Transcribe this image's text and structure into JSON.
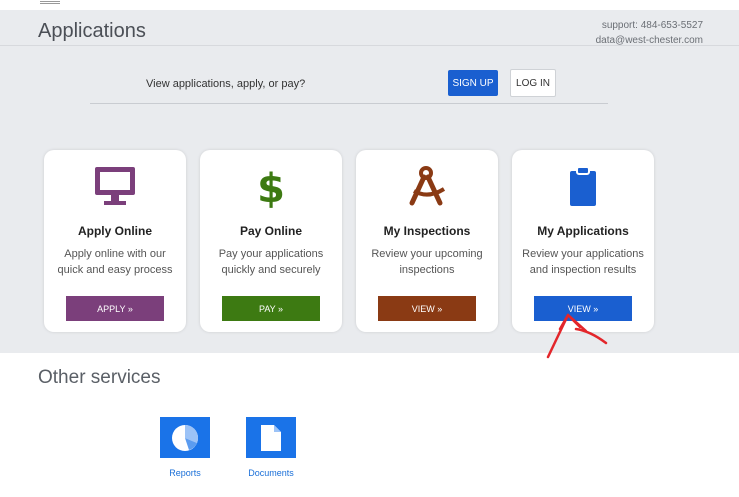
{
  "header": {
    "title": "Applications",
    "support_phone": "support: 484-653-5527",
    "support_email": "data@west-chester.com"
  },
  "prompt": {
    "text": "View applications, apply, or pay?",
    "signup_label": "SIGN UP",
    "login_label": "LOG IN"
  },
  "cards": [
    {
      "title": "Apply Online",
      "desc_line1": "Apply online with our",
      "desc_line2": "quick and easy process",
      "button": "APPLY »",
      "icon": "monitor-icon",
      "color": "#7b3f7b"
    },
    {
      "title": "Pay Online",
      "desc_line1": "Pay your applications",
      "desc_line2": "quickly and securely",
      "button": "PAY »",
      "icon": "dollar-icon",
      "color": "#3d7a12"
    },
    {
      "title": "My Inspections",
      "desc_line1": "Review your upcoming",
      "desc_line2": "inspections",
      "button": "VIEW »",
      "icon": "compass-icon",
      "color": "#8a3a14"
    },
    {
      "title": "My Applications",
      "desc_line1": "Review your applications",
      "desc_line2": "and inspection results",
      "button": "VIEW »",
      "icon": "clipboard-icon",
      "color": "#1a5fd0"
    }
  ],
  "other_services": {
    "heading": "Other services",
    "items": [
      {
        "label": "Reports",
        "icon": "pie-chart-icon"
      },
      {
        "label": "Documents",
        "icon": "document-icon"
      }
    ]
  },
  "colors": {
    "accent": "#1a5fd0",
    "annotation": "#e3262b",
    "banner_bg": "#e9ebee"
  }
}
